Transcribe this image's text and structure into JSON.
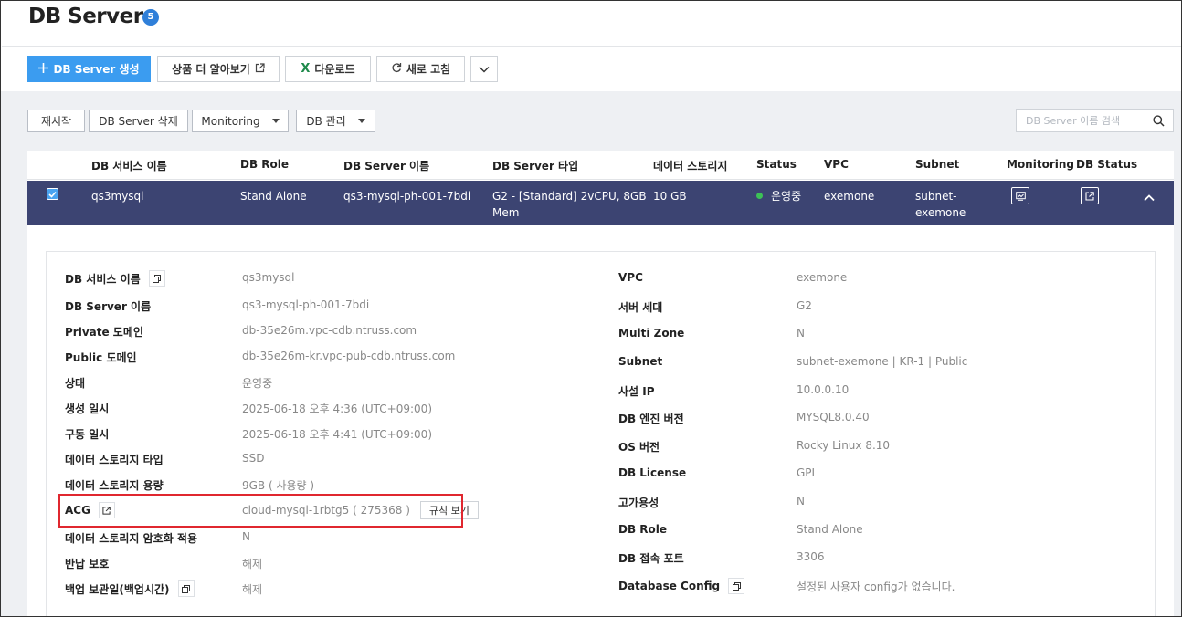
{
  "header": {
    "title": "DB Server",
    "count": "5"
  },
  "toolbar": {
    "create_label": "DB Server 생성",
    "learn_more_label": "상품 더 알아보기",
    "download_label": "다운로드",
    "refresh_label": "새로 고침"
  },
  "actions": {
    "restart_label": "재시작",
    "delete_label": "DB Server 삭제",
    "monitoring_label": "Monitoring",
    "db_manage_label": "DB 관리"
  },
  "search": {
    "placeholder": "DB Server 이름 검색"
  },
  "table": {
    "columns": [
      "DB 서비스 이름",
      "DB Role",
      "DB Server 이름",
      "DB Server 타입",
      "데이터 스토리지",
      "Status",
      "VPC",
      "Subnet",
      "Monitoring",
      "DB Status"
    ],
    "row": {
      "service_name": "qs3mysql",
      "role": "Stand Alone",
      "server_name": "qs3-mysql-ph-001-7bdi",
      "server_type_line1": "G2 - [Standard] 2vCPU, 8GB",
      "server_type_line2": "Mem",
      "storage": "10 GB",
      "status": "운영중",
      "vpc": "exemone",
      "subnet_line1": "subnet-",
      "subnet_line2": "exemone"
    }
  },
  "details": {
    "left": [
      {
        "label": "DB 서비스 이름",
        "value": "qs3mysql"
      },
      {
        "label": "DB Server 이름",
        "value": "qs3-mysql-ph-001-7bdi"
      },
      {
        "label": "Private 도메인",
        "value": "db-35e26m.vpc-cdb.ntruss.com"
      },
      {
        "label": "Public 도메인",
        "value": "db-35e26m-kr.vpc-pub-cdb.ntruss.com"
      },
      {
        "label": "상태",
        "value": "운영중"
      },
      {
        "label": "생성 일시",
        "value": "2025-06-18 오후 4:36 (UTC+09:00)"
      },
      {
        "label": "구동 일시",
        "value": "2025-06-18 오후 4:41 (UTC+09:00)"
      },
      {
        "label": "데이터 스토리지 타입",
        "value": "SSD"
      },
      {
        "label": "데이터 스토리지 용량",
        "value": "9GB ( 사용량 )"
      },
      {
        "label": "ACG",
        "value": "cloud-mysql-1rbtg5 ( 275368 )",
        "button": "규칙 보기"
      },
      {
        "label": "데이터 스토리지 암호화 적용",
        "value": "N"
      },
      {
        "label": "반납 보호",
        "value": "해제"
      },
      {
        "label": "백업 보관일(백업시간)",
        "value": "해제"
      }
    ],
    "right": [
      {
        "label": "VPC",
        "value": "exemone"
      },
      {
        "label": "서버 세대",
        "value": "G2"
      },
      {
        "label": "Multi Zone",
        "value": "N"
      },
      {
        "label": "Subnet",
        "value": "subnet-exemone | KR-1 | Public"
      },
      {
        "label": "사설 IP",
        "value": "10.0.0.10"
      },
      {
        "label": "DB 엔진 버전",
        "value": "MYSQL8.0.40"
      },
      {
        "label": "OS 버전",
        "value": "Rocky Linux 8.10"
      },
      {
        "label": "DB License",
        "value": "GPL"
      },
      {
        "label": "고가용성",
        "value": "N"
      },
      {
        "label": "DB Role",
        "value": "Stand Alone"
      },
      {
        "label": "DB 접속 포트",
        "value": "3306"
      },
      {
        "label": "Database Config",
        "value": "설정된 사용자 config가 없습니다."
      }
    ]
  },
  "colors": {
    "primary": "#3b9cf0",
    "selected_row": "#3c4472",
    "status_running": "#3cc156",
    "highlight": "#e0272f"
  }
}
